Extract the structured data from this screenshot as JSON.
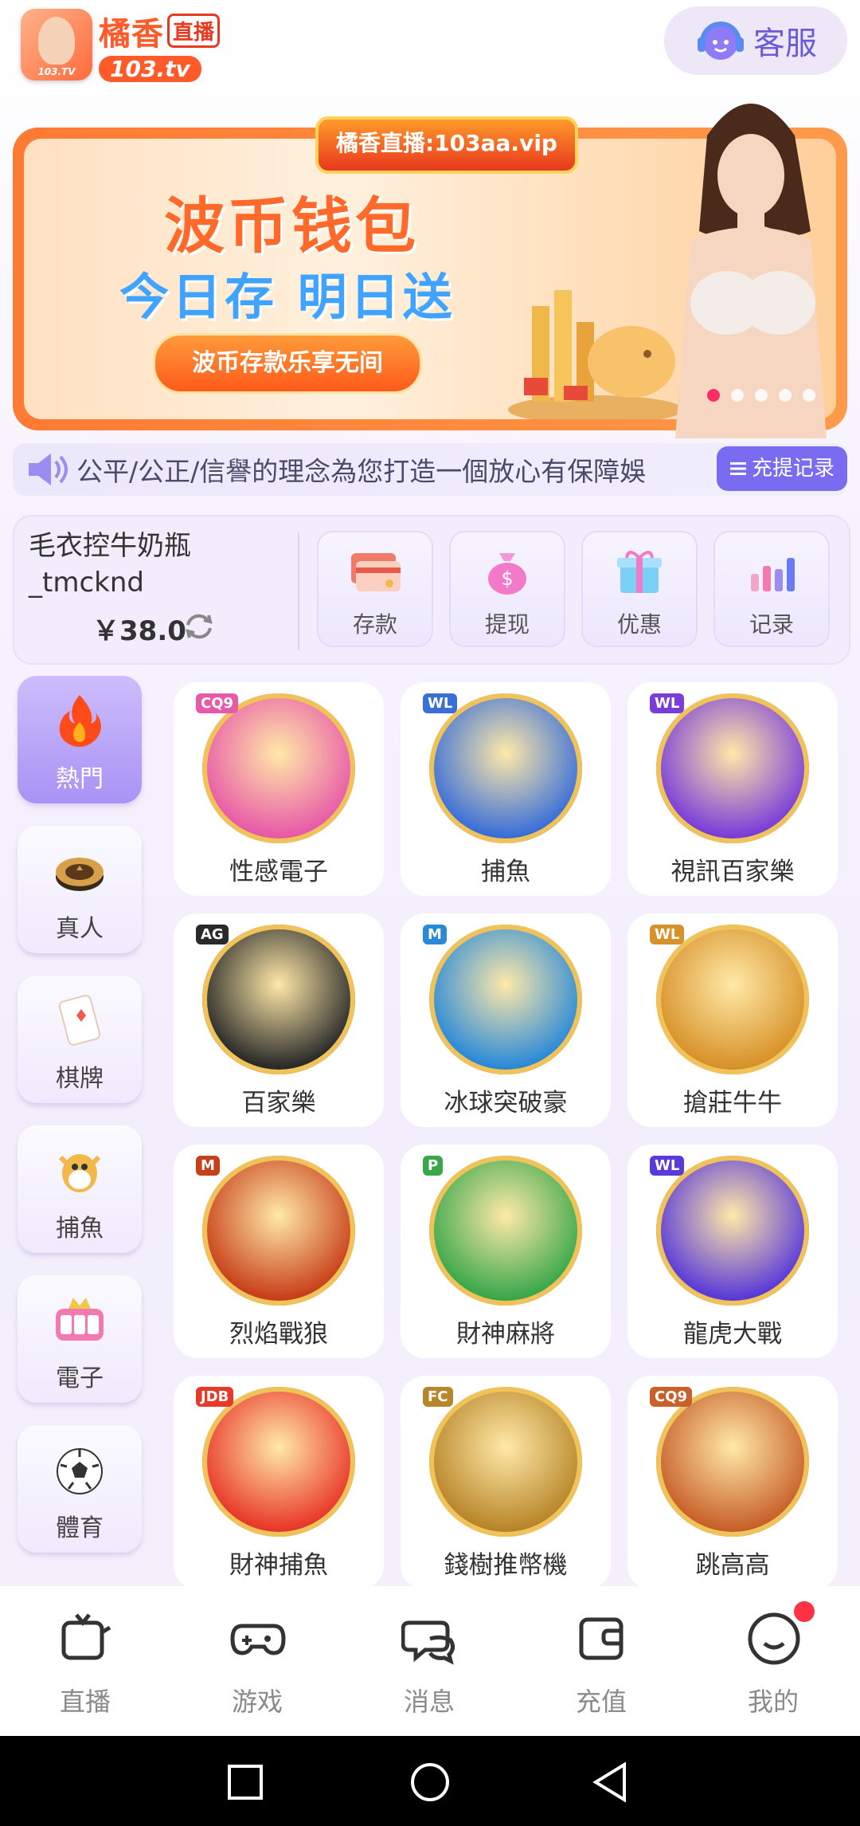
{
  "header": {
    "logo_badge": "103.TV",
    "logo_name": "橘香",
    "logo_live": "直播",
    "logo_domain": "103.tv",
    "service_label": "客服"
  },
  "banner": {
    "tag": "橘香直播:103aa.vip",
    "title": "波币钱包",
    "subtitle": "今日存 明日送",
    "cta": "波币存款乐享无间",
    "slide_count": 5,
    "active_slide": 0
  },
  "marquee": {
    "text": "公平/公正/信譽的理念為您打造一個放心有保障娛",
    "record_button": "充提记录"
  },
  "account": {
    "username": "毛衣控牛奶瓶_tmcknd",
    "balance": "￥38.0",
    "actions": [
      {
        "label": "存款",
        "icon": "card-icon"
      },
      {
        "label": "提现",
        "icon": "money-bag-icon"
      },
      {
        "label": "优惠",
        "icon": "gift-icon"
      },
      {
        "label": "记录",
        "icon": "chart-icon"
      }
    ]
  },
  "categories": [
    {
      "label": "熱門",
      "icon": "fire-icon",
      "active": true
    },
    {
      "label": "真人",
      "icon": "chip-icon",
      "active": false
    },
    {
      "label": "棋牌",
      "icon": "card-icon",
      "active": false
    },
    {
      "label": "捕魚",
      "icon": "fish-icon",
      "active": false
    },
    {
      "label": "電子",
      "icon": "slot-icon",
      "active": false
    },
    {
      "label": "體育",
      "icon": "soccer-ball-icon",
      "active": false
    }
  ],
  "games": [
    {
      "label": "性感電子",
      "provider": "CQ9",
      "color": "#e85aa8"
    },
    {
      "label": "捕魚",
      "provider": "WL",
      "color": "#3a6fd8"
    },
    {
      "label": "視訊百家樂",
      "provider": "WL",
      "color": "#7a3ed8"
    },
    {
      "label": "百家樂",
      "provider": "AG",
      "color": "#2a2a2a"
    },
    {
      "label": "冰球突破豪",
      "provider": "M",
      "color": "#2a8ad8"
    },
    {
      "label": "搶莊牛牛",
      "provider": "WL",
      "color": "#d8922a"
    },
    {
      "label": "烈焰戰狼",
      "provider": "M",
      "color": "#c8401a"
    },
    {
      "label": "財神麻將",
      "provider": "P",
      "color": "#3aa84a"
    },
    {
      "label": "龍虎大戰",
      "provider": "WL",
      "color": "#5a3ad8"
    },
    {
      "label": "財神捕魚",
      "provider": "JDB",
      "color": "#e8382a"
    },
    {
      "label": "錢樹推幣機",
      "provider": "FC",
      "color": "#b8862a"
    },
    {
      "label": "跳高高",
      "provider": "CQ9",
      "color": "#c8602a"
    }
  ],
  "tabbar": [
    {
      "label": "直播",
      "icon": "camera-icon"
    },
    {
      "label": "游戏",
      "icon": "gamepad-icon"
    },
    {
      "label": "消息",
      "icon": "chat-icon"
    },
    {
      "label": "充值",
      "icon": "wallet-icon"
    },
    {
      "label": "我的",
      "icon": "smile-icon"
    }
  ],
  "colors": {
    "accent": "#7a6cf0",
    "brand": "#ff5a2a",
    "badge": "#ff3344"
  }
}
